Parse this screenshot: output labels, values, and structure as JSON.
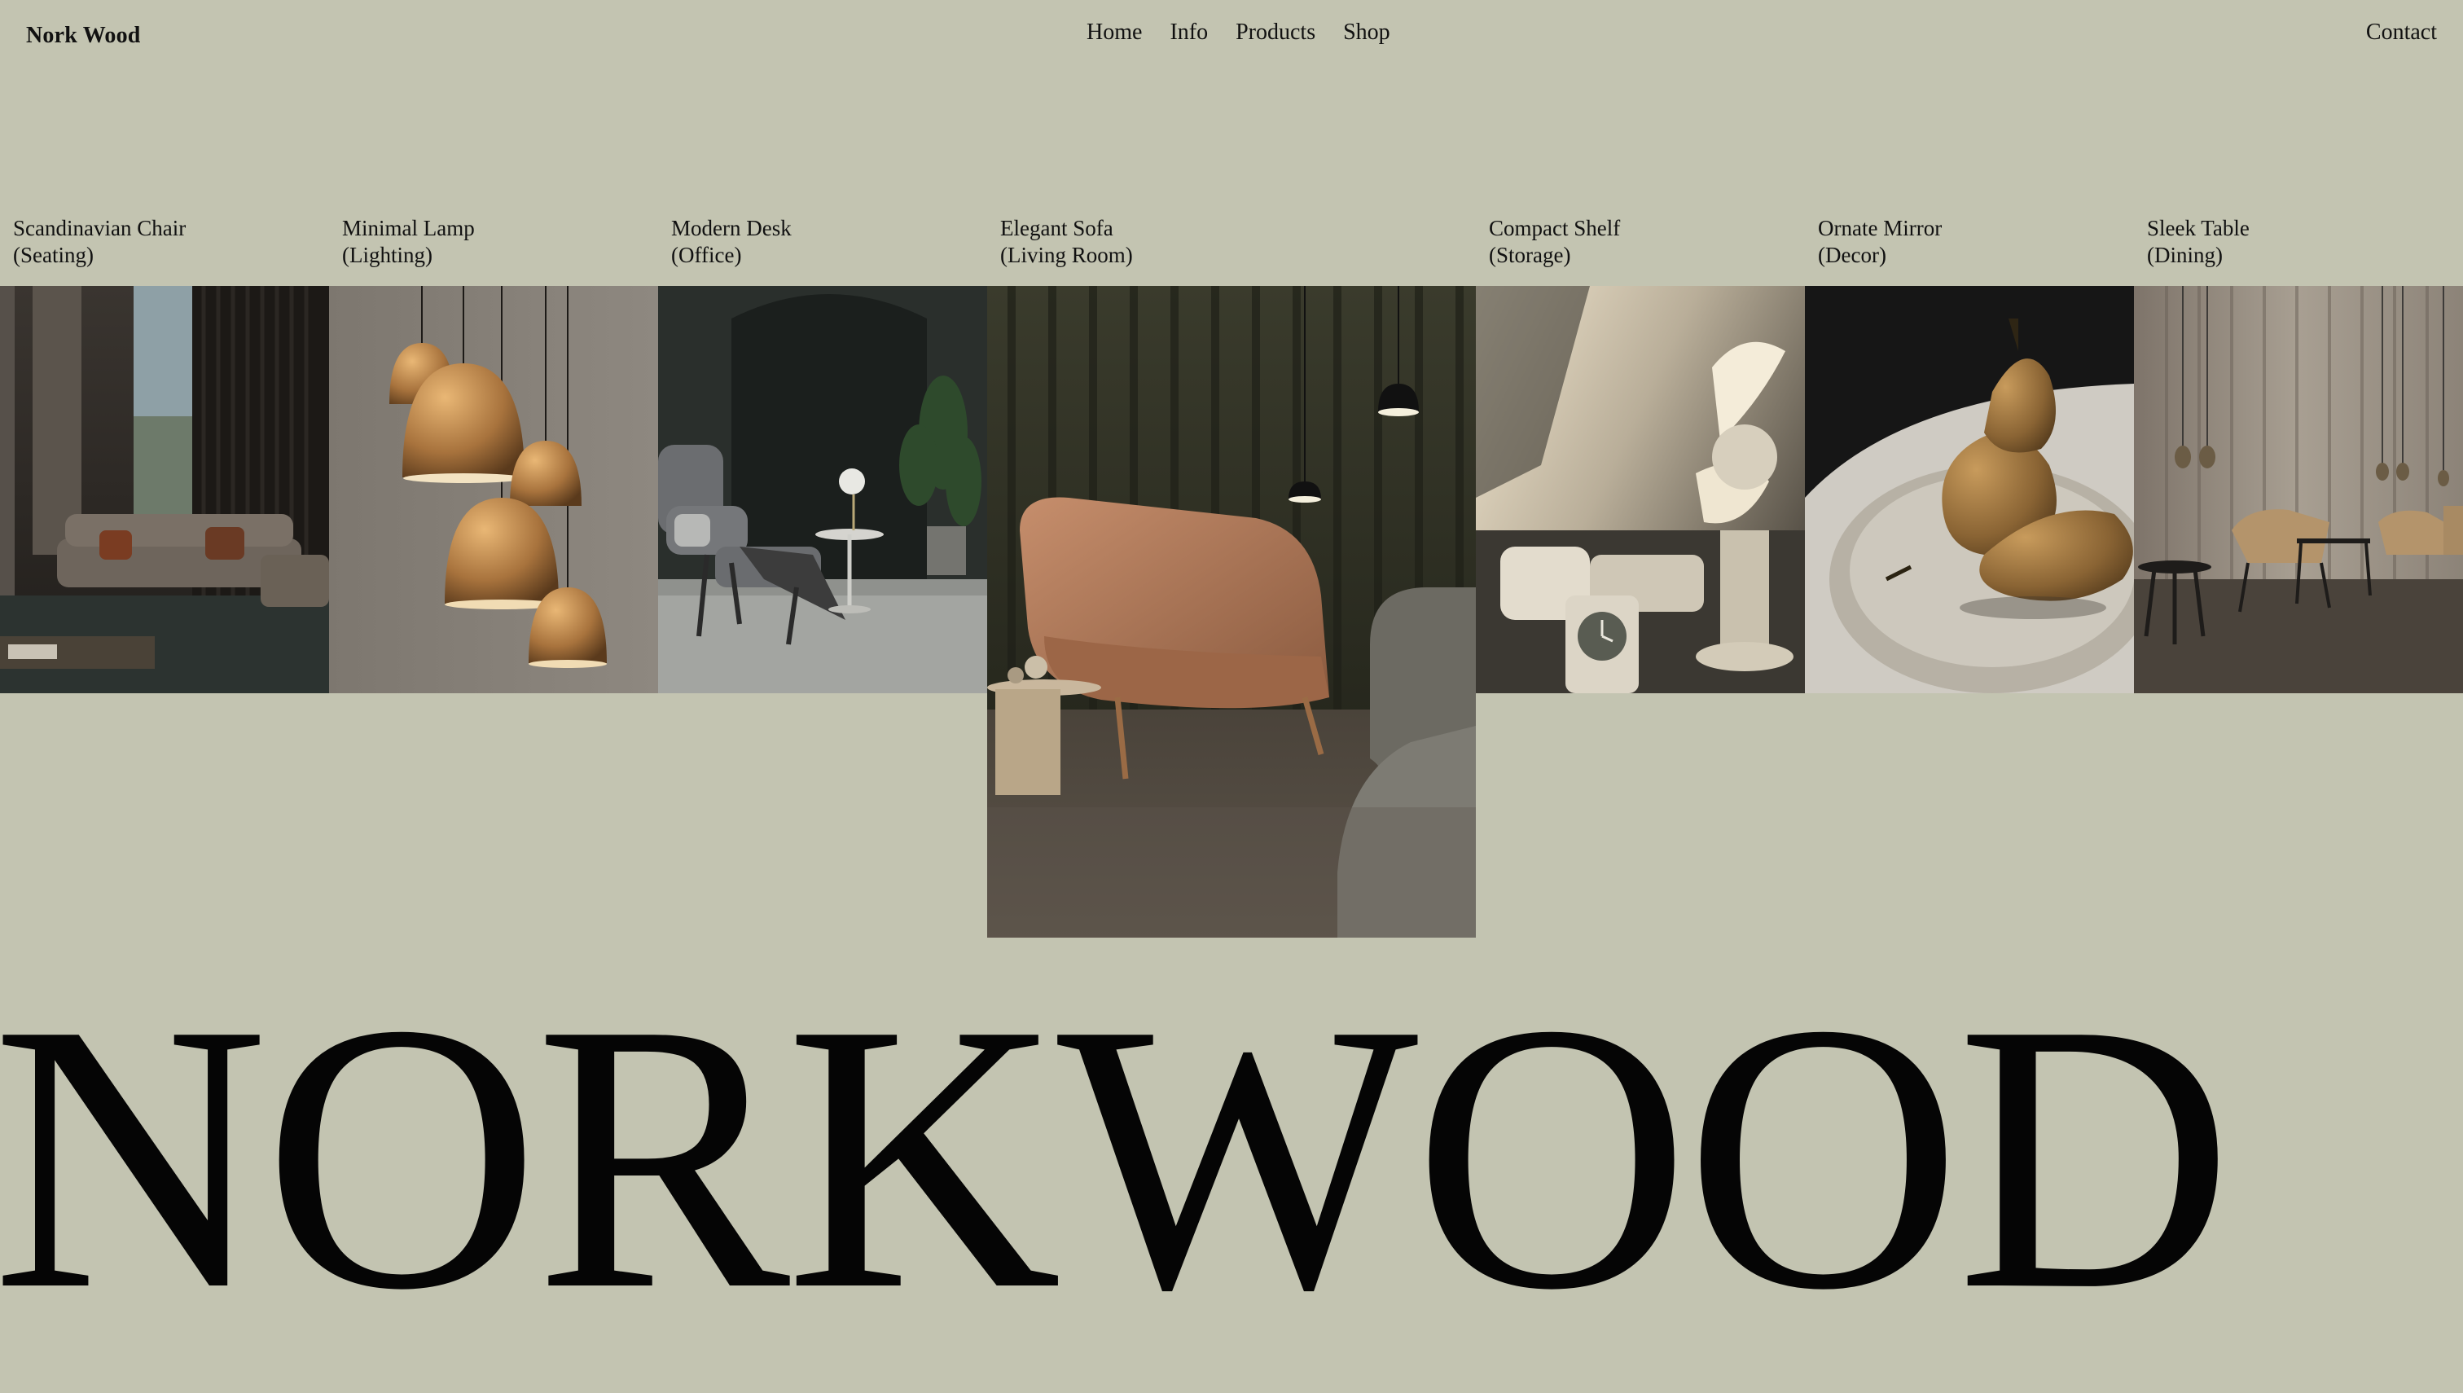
{
  "header": {
    "brand": "Nork Wood",
    "nav": [
      "Home",
      "Info",
      "Products",
      "Shop"
    ],
    "contact": "Contact"
  },
  "products": [
    {
      "name": "Scandinavian Chair",
      "category": "(Seating)"
    },
    {
      "name": "Minimal Lamp",
      "category": "(Lighting)"
    },
    {
      "name": "Modern Desk",
      "category": "(Office)"
    },
    {
      "name": "Elegant Sofa",
      "category": "(Living Room)"
    },
    {
      "name": "Compact Shelf",
      "category": "(Storage)"
    },
    {
      "name": "Ornate Mirror",
      "category": "(Decor)"
    },
    {
      "name": "Sleek Table",
      "category": "(Dining)"
    }
  ],
  "wordmark": "NORKWOOD",
  "colors": {
    "background": "#c3c4b1",
    "text": "#111111"
  }
}
